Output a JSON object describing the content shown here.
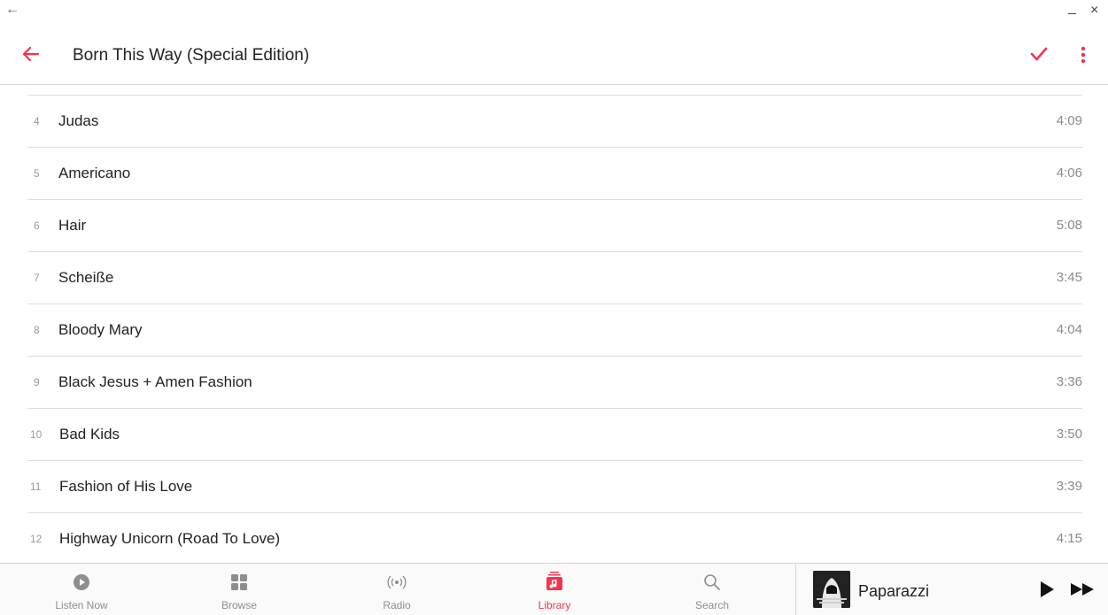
{
  "window": {
    "back_glyph": "←",
    "minimize_glyph": "_",
    "close_glyph": "×"
  },
  "appbar": {
    "title": "Born This Way (Special Edition)",
    "accent": "#f2364f",
    "back_icon": "arrow-left-icon",
    "check_icon": "checkmark-icon",
    "more_icon": "more-vertical-icon"
  },
  "tracks": [
    {
      "num": "4",
      "title": "Judas",
      "duration": "4:09"
    },
    {
      "num": "5",
      "title": "Americano",
      "duration": "4:06"
    },
    {
      "num": "6",
      "title": "Hair",
      "duration": "5:08"
    },
    {
      "num": "7",
      "title": "Scheiße",
      "duration": "3:45"
    },
    {
      "num": "8",
      "title": "Bloody Mary",
      "duration": "4:04"
    },
    {
      "num": "9",
      "title": "Black Jesus + Amen Fashion",
      "duration": "3:36"
    },
    {
      "num": "10",
      "title": "Bad Kids",
      "duration": "3:50"
    },
    {
      "num": "11",
      "title": "Fashion of His Love",
      "duration": "3:39"
    },
    {
      "num": "12",
      "title": "Highway Unicorn (Road To Love)",
      "duration": "4:15"
    }
  ],
  "tabs": [
    {
      "label": "Listen Now",
      "icon": "play-circle-icon"
    },
    {
      "label": "Browse",
      "icon": "grid-icon"
    },
    {
      "label": "Radio",
      "icon": "radio-broadcast-icon"
    },
    {
      "label": "Library",
      "icon": "music-library-icon",
      "active": true
    },
    {
      "label": "Search",
      "icon": "search-icon"
    }
  ],
  "now_playing": {
    "title": "Paparazzi",
    "play_icon": "play-icon",
    "next_icon": "fast-forward-icon"
  }
}
